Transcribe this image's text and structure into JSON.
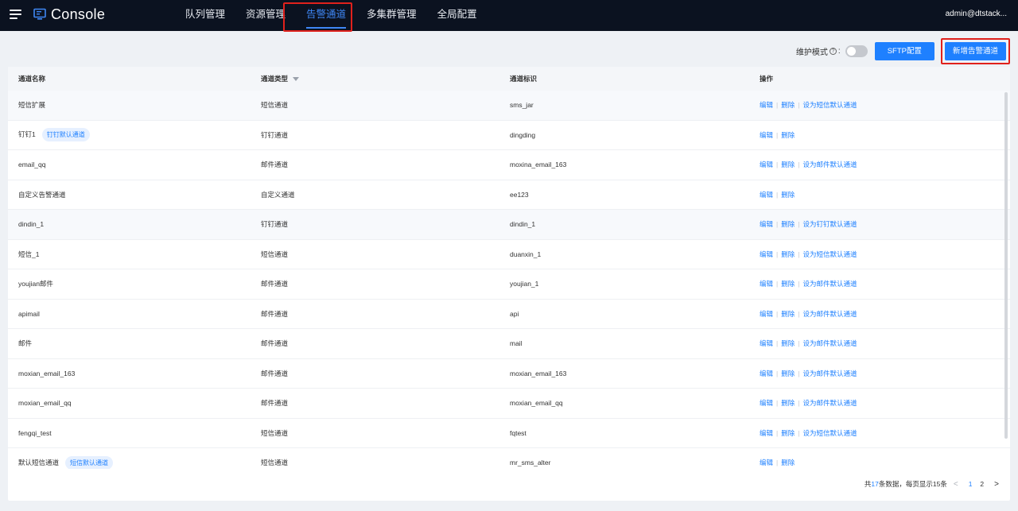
{
  "header": {
    "title": "Console",
    "user": "admin@dtstack...",
    "nav": [
      "队列管理",
      "资源管理",
      "告警通道",
      "多集群管理",
      "全局配置"
    ],
    "active_index": 2
  },
  "toolbar": {
    "maintenance_label": "维护模式",
    "help_glyph": "?",
    "colon": ":",
    "sftp_button": "SFTP配置",
    "add_button": "新增告警通道"
  },
  "table": {
    "columns": [
      "通道名称",
      "通道类型",
      "通道标识",
      "操作"
    ],
    "rows": [
      {
        "name": "短信扩展",
        "tag": "",
        "type": "短信通道",
        "id": "sms_jar",
        "actions": [
          "编辑",
          "删除",
          "设为短信默认通道"
        ]
      },
      {
        "name": "钉钉1",
        "tag": "钉钉默认通道",
        "type": "钉钉通道",
        "id": "dingding",
        "actions": [
          "编辑",
          "删除"
        ]
      },
      {
        "name": "email_qq",
        "tag": "",
        "type": "邮件通道",
        "id": "moxina_email_163",
        "actions": [
          "编辑",
          "删除",
          "设为邮件默认通道"
        ]
      },
      {
        "name": "自定义告警通道",
        "tag": "",
        "type": "自定义通道",
        "id": "ee123",
        "actions": [
          "编辑",
          "删除"
        ]
      },
      {
        "name": "dindin_1",
        "tag": "",
        "type": "钉钉通道",
        "id": "dindin_1",
        "actions": [
          "编辑",
          "删除",
          "设为钉钉默认通道"
        ]
      },
      {
        "name": "短信_1",
        "tag": "",
        "type": "短信通道",
        "id": "duanxin_1",
        "actions": [
          "编辑",
          "删除",
          "设为短信默认通道"
        ]
      },
      {
        "name": "youjian邮件",
        "tag": "",
        "type": "邮件通道",
        "id": "youjian_1",
        "actions": [
          "编辑",
          "删除",
          "设为邮件默认通道"
        ]
      },
      {
        "name": "apimail",
        "tag": "",
        "type": "邮件通道",
        "id": "api",
        "actions": [
          "编辑",
          "删除",
          "设为邮件默认通道"
        ]
      },
      {
        "name": "邮件",
        "tag": "",
        "type": "邮件通道",
        "id": "mail",
        "actions": [
          "编辑",
          "删除",
          "设为邮件默认通道"
        ]
      },
      {
        "name": "moxian_email_163",
        "tag": "",
        "type": "邮件通道",
        "id": "moxian_email_163",
        "actions": [
          "编辑",
          "删除",
          "设为邮件默认通道"
        ]
      },
      {
        "name": "moxian_email_qq",
        "tag": "",
        "type": "邮件通道",
        "id": "moxian_email_qq",
        "actions": [
          "编辑",
          "删除",
          "设为邮件默认通道"
        ]
      },
      {
        "name": "fengqi_test",
        "tag": "",
        "type": "短信通道",
        "id": "fqtest",
        "actions": [
          "编辑",
          "删除",
          "设为短信默认通道"
        ]
      },
      {
        "name": "默认短信通道",
        "tag": "短信默认通道",
        "type": "短信通道",
        "id": "mr_sms_alter",
        "actions": [
          "编辑",
          "删除"
        ]
      }
    ]
  },
  "pagination": {
    "prefix": "共",
    "total": "17",
    "suffix": "条数据，每页显示15条",
    "pages": [
      "1",
      "2"
    ],
    "current": "1",
    "prev_glyph": "<",
    "next_glyph": ">"
  },
  "colors": {
    "topbar": "#0b1220",
    "accent": "#1e80ff",
    "highlight": "#e0211c"
  }
}
